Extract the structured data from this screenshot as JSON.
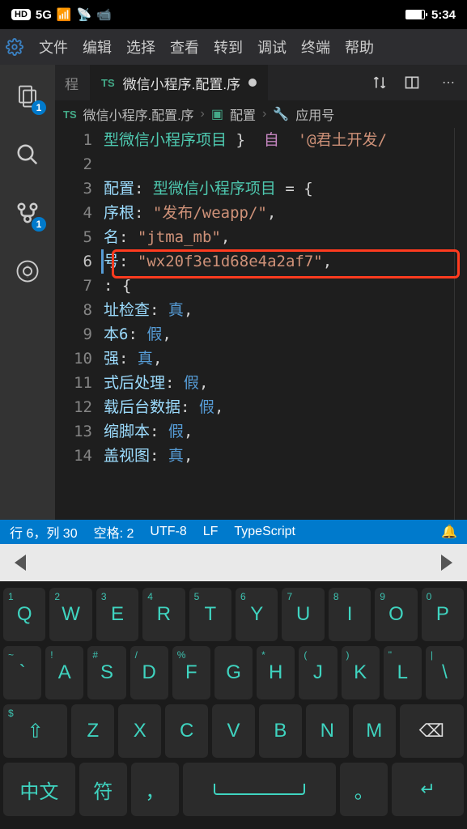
{
  "status": {
    "hd": "HD",
    "net": "5G",
    "time": "5:34"
  },
  "menu": {
    "items": [
      "文件",
      "编辑",
      "选择",
      "查看",
      "转到",
      "调试",
      "终端",
      "帮助"
    ]
  },
  "activity": {
    "explorer_badge": "1",
    "scm_badge": "1"
  },
  "tabs": {
    "stub": "程",
    "active_prefix": "TS",
    "active_label": "微信小程序.配置.序"
  },
  "breadcrumbs": {
    "prefix": "TS",
    "file": "微信小程序.配置.序",
    "folder": "配置",
    "symbol": "应用号"
  },
  "code": {
    "lines": [
      {
        "n": "1",
        "html": "<span class='tk-type'>型微信小程序项目</span> <span class='tk-punc'>}</span>  <span class='tk-kw'>自</span>  <span class='tk-str'>'@君土开发/</span>"
      },
      {
        "n": "2",
        "html": ""
      },
      {
        "n": "3",
        "html": "<span class='tk-key'>配置</span><span class='tk-punc'>:</span> <span class='tk-type'>型微信小程序项目</span> <span class='tk-punc'>= {</span>"
      },
      {
        "n": "4",
        "html": "<span class='tk-key'>序根</span><span class='tk-punc'>:</span> <span class='tk-str'>\"发布/weapp/\"</span><span class='tk-punc'>,</span>"
      },
      {
        "n": "5",
        "html": "<span class='tk-key'>名</span><span class='tk-punc'>:</span> <span class='tk-str'>\"jtma_mb\"</span><span class='tk-punc'>,</span>"
      },
      {
        "n": "6",
        "html": "<span class='tk-key'>号</span><span class='tk-punc'>:</span> <span class='tk-str'>\"wx20f3e1d68e4a2af7\"</span><span class='tk-punc'>,</span>"
      },
      {
        "n": "7",
        "html": "<span class='tk-punc'>: {</span>"
      },
      {
        "n": "8",
        "html": "<span class='tk-key'>址检查</span><span class='tk-punc'>:</span> <span class='tk-bool'>真</span><span class='tk-punc'>,</span>"
      },
      {
        "n": "9",
        "html": "<span class='tk-key'>本6</span><span class='tk-punc'>:</span> <span class='tk-bool'>假</span><span class='tk-punc'>,</span>"
      },
      {
        "n": "10",
        "html": "<span class='tk-key'>强</span><span class='tk-punc'>:</span> <span class='tk-bool'>真</span><span class='tk-punc'>,</span>"
      },
      {
        "n": "11",
        "html": "<span class='tk-key'>式后处理</span><span class='tk-punc'>:</span> <span class='tk-bool'>假</span><span class='tk-punc'>,</span>"
      },
      {
        "n": "12",
        "html": "<span class='tk-key'>载后台数据</span><span class='tk-punc'>:</span> <span class='tk-bool'>假</span><span class='tk-punc'>,</span>"
      },
      {
        "n": "13",
        "html": "<span class='tk-key'>缩脚本</span><span class='tk-punc'>:</span> <span class='tk-bool'>假</span><span class='tk-punc'>,</span>"
      },
      {
        "n": "14",
        "html": "<span class='tk-key'>盖视图</span><span class='tk-punc'>:</span> <span class='tk-bool'>真</span><span class='tk-punc'>,</span>"
      }
    ]
  },
  "statusbar": {
    "pos": "行 6，列 30",
    "indent": "空格: 2",
    "encoding": "UTF-8",
    "eol": "LF",
    "lang": "TypeScript"
  },
  "keyboard": {
    "row1": [
      {
        "sub": "1",
        "main": "Q"
      },
      {
        "sub": "2",
        "main": "W"
      },
      {
        "sub": "3",
        "main": "E"
      },
      {
        "sub": "4",
        "main": "R"
      },
      {
        "sub": "5",
        "main": "T"
      },
      {
        "sub": "6",
        "main": "Y"
      },
      {
        "sub": "7",
        "main": "U"
      },
      {
        "sub": "8",
        "main": "I"
      },
      {
        "sub": "9",
        "main": "O"
      },
      {
        "sub": "0",
        "main": "P"
      }
    ],
    "row2": [
      {
        "sub": "~",
        "main": "`"
      },
      {
        "sub": "!",
        "main": "A"
      },
      {
        "sub": "#",
        "main": "S"
      },
      {
        "sub": "/",
        "main": "D"
      },
      {
        "sub": "%",
        "main": "F"
      },
      {
        "sub": "",
        "main": "G"
      },
      {
        "sub": "*",
        "main": "H"
      },
      {
        "sub": "(",
        "main": "J"
      },
      {
        "sub": ")",
        "main": "K"
      },
      {
        "sub": "\"",
        "main": "L"
      },
      {
        "sub": "|",
        "main": "\\"
      }
    ],
    "row3": [
      {
        "sub": "$",
        "main": "⇧"
      },
      {
        "sub": "",
        "main": "Z"
      },
      {
        "sub": "",
        "main": "X"
      },
      {
        "sub": "",
        "main": "C"
      },
      {
        "sub": "",
        "main": "V"
      },
      {
        "sub": "",
        "main": "B"
      },
      {
        "sub": "",
        "main": "N"
      },
      {
        "sub": "",
        "main": "M"
      },
      {
        "sub": "",
        "main": "⌫"
      }
    ],
    "row4": {
      "lang": "中文",
      "sym": "符",
      "comma": "，",
      "period": "。",
      "enter": "↵"
    }
  }
}
